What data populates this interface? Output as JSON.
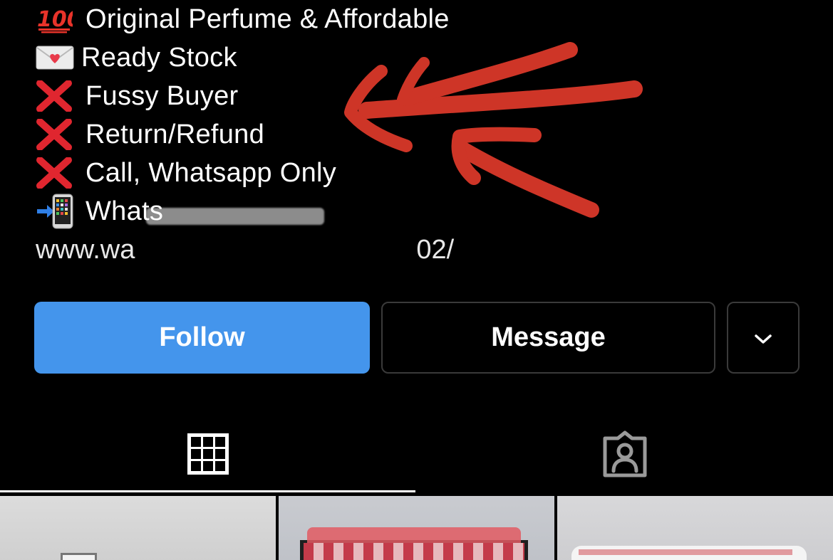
{
  "bio": {
    "lines": [
      {
        "icon": "hundred-points-icon",
        "text": "Original Perfume & Affordable"
      },
      {
        "icon": "love-letter-icon",
        "text": "Ready Stock"
      },
      {
        "icon": "cross-mark-icon",
        "text": "Fussy Buyer"
      },
      {
        "icon": "cross-mark-icon",
        "text": "Return/Refund"
      },
      {
        "icon": "cross-mark-icon",
        "text": "Call, Whatsapp Only"
      },
      {
        "icon": "phone-arrow-icon",
        "text": "Whats"
      }
    ],
    "link_text": "www.wa",
    "link_tail": "02/"
  },
  "actions": {
    "follow_label": "Follow",
    "message_label": "Message",
    "more_icon": "chevron-down-icon"
  },
  "tabs": [
    {
      "icon": "grid-icon",
      "active": true
    },
    {
      "icon": "tagged-person-icon",
      "active": false
    }
  ],
  "colors": {
    "follow_blue": "#4495ec",
    "background": "#000000",
    "annotation_red": "#e03a2b"
  }
}
